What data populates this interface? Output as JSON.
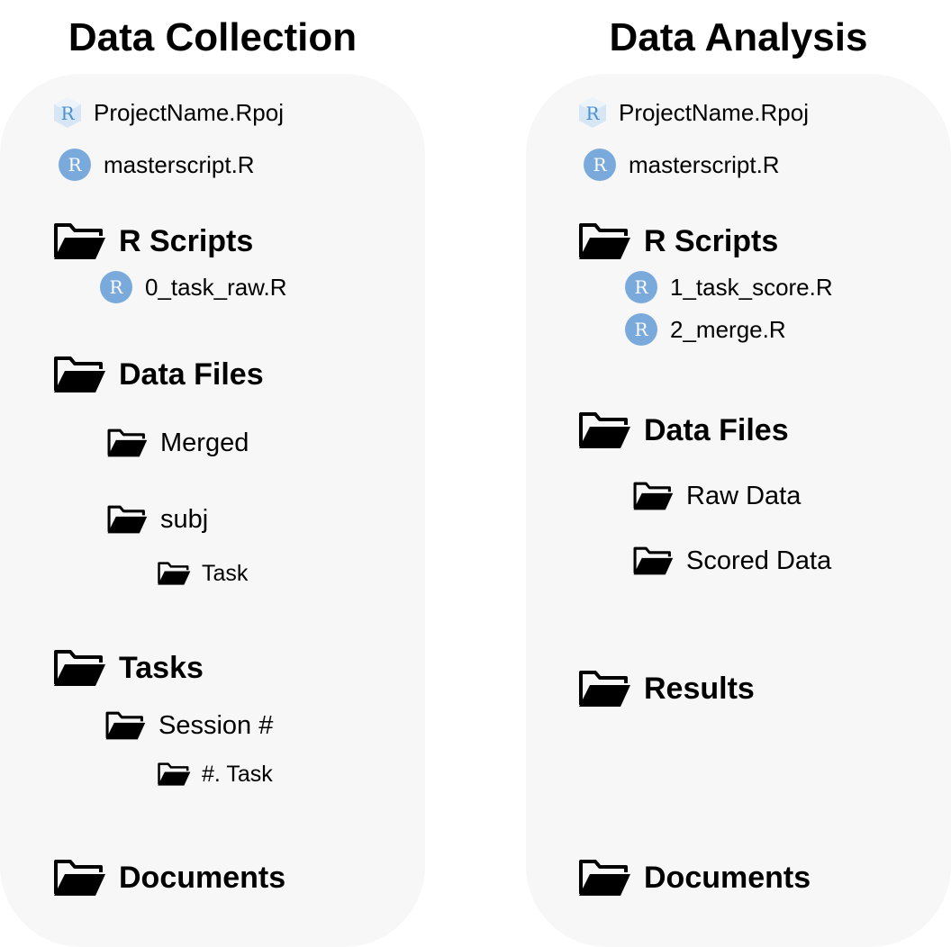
{
  "left": {
    "title": "Data Collection",
    "project_file": "ProjectName.Rpoj",
    "master_script": "masterscript.R",
    "r_scripts": {
      "label": "R Scripts",
      "files": [
        "0_task_raw.R"
      ]
    },
    "data_files": {
      "label": "Data Files",
      "merged": "Merged",
      "subj": "subj",
      "subj_task": "Task"
    },
    "tasks": {
      "label": "Tasks",
      "session": "Session #",
      "session_task": "#. Task"
    },
    "documents": "Documents"
  },
  "right": {
    "title": "Data Analysis",
    "project_file": "ProjectName.Rpoj",
    "master_script": "masterscript.R",
    "r_scripts": {
      "label": "R Scripts",
      "files": [
        "1_task_score.R",
        "2_merge.R"
      ]
    },
    "data_files": {
      "label": "Data Files",
      "raw": "Raw Data",
      "scored": "Scored Data"
    },
    "results": "Results",
    "documents": "Documents"
  },
  "icons": {
    "r_script": "r-script-icon",
    "r_project": "r-project-icon",
    "folder": "folder-open-icon"
  },
  "colors": {
    "panel_bg": "#f7f7f7",
    "r_icon": "#7aa9dc",
    "rproj_icon": "#bcd9f2",
    "folder": "#000000"
  }
}
